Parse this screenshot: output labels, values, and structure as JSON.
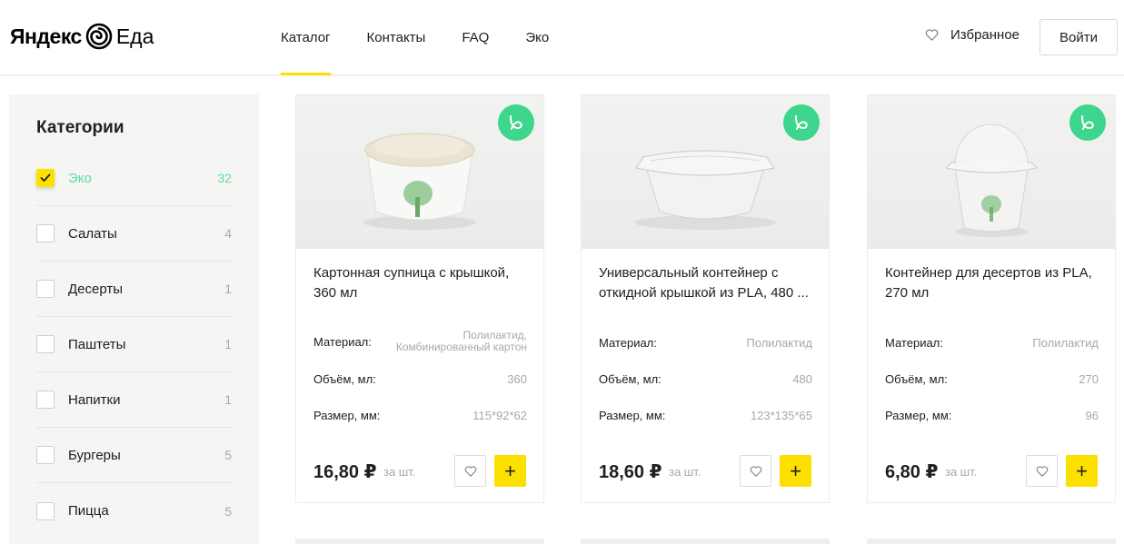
{
  "header": {
    "logo_brand": "Яндекс",
    "logo_product": "Еда",
    "nav": [
      "Каталог",
      "Контакты",
      "FAQ",
      "Эко"
    ],
    "active_nav": "Каталог",
    "favorites_label": "Избранное",
    "login_label": "Войти"
  },
  "sidebar": {
    "title": "Категории",
    "categories": [
      {
        "label": "Эко",
        "count": "32",
        "checked": true
      },
      {
        "label": "Салаты",
        "count": "4",
        "checked": false
      },
      {
        "label": "Десерты",
        "count": "1",
        "checked": false
      },
      {
        "label": "Паштеты",
        "count": "1",
        "checked": false
      },
      {
        "label": "Напитки",
        "count": "1",
        "checked": false
      },
      {
        "label": "Бургеры",
        "count": "5",
        "checked": false
      },
      {
        "label": "Пицца",
        "count": "5",
        "checked": false
      }
    ]
  },
  "products": [
    {
      "title": "Картонная супница с крышкой, 360 мл",
      "attrs": {
        "material_name": "Материал:",
        "material_value": "Полилактид, Комбинированный картон",
        "volume_name": "Объём, мл:",
        "volume_value": "360",
        "size_name": "Размер, мм:",
        "size_value": "115*92*62"
      },
      "price": "16,80 ₽",
      "per": "за шт.",
      "add_label": "+"
    },
    {
      "title": "Универсальный контейнер с откидной крышкой из PLA, 480 ...",
      "attrs": {
        "material_name": "Материал:",
        "material_value": "Полилактид",
        "volume_name": "Объём, мл:",
        "volume_value": "480",
        "size_name": "Размер, мм:",
        "size_value": "123*135*65"
      },
      "price": "18,60 ₽",
      "per": "за шт.",
      "add_label": "+"
    },
    {
      "title": "Контейнер для десертов из PLA, 270 мл",
      "attrs": {
        "material_name": "Материал:",
        "material_value": "Полилактид",
        "volume_name": "Объём, мл:",
        "volume_value": "270",
        "size_name": "Размер, мм:",
        "size_value": "96"
      },
      "price": "6,80 ₽",
      "per": "за шт.",
      "add_label": "+"
    }
  ],
  "colors": {
    "accent_yellow": "#fce000",
    "eco_green": "#3dd68c",
    "active_category": "#5fd8a7",
    "muted_text": "#a8a8a8"
  },
  "icons": {
    "favorites": "heart-outline-icon",
    "eco_badge": "leaf-icon",
    "checkbox": "check-icon"
  }
}
